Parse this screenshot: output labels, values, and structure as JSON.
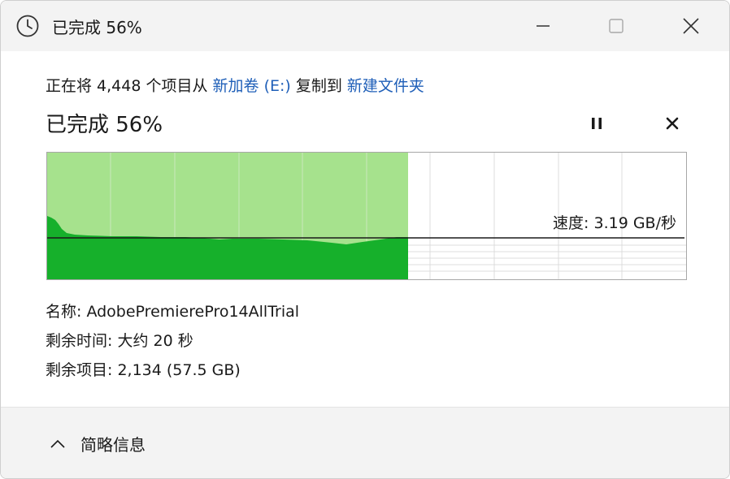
{
  "window": {
    "title": "已完成 56%",
    "icon": "clock-icon"
  },
  "copy": {
    "prefix": "正在将 4,448 个项目从",
    "source": "新加卷 (E:)",
    "middle": "复制到",
    "destination": "新建文件夹"
  },
  "progress": {
    "label": "已完成 56%",
    "percent": 56
  },
  "speed": {
    "text": "速度: 3.19 GB/秒"
  },
  "details": {
    "name_label": "名称:",
    "name_value": "AdobePremierePro14AllTrial",
    "time_label": "剩余时间:",
    "time_value": "大约 20 秒",
    "items_label": "剩余项目:",
    "items_value": "2,134 (57.5 GB)"
  },
  "footer": {
    "toggle_label": "简略信息"
  },
  "colors": {
    "accent_link": "#1f5fb8",
    "graph_light": "#a6e28d",
    "graph_dark": "#16b02b"
  }
}
